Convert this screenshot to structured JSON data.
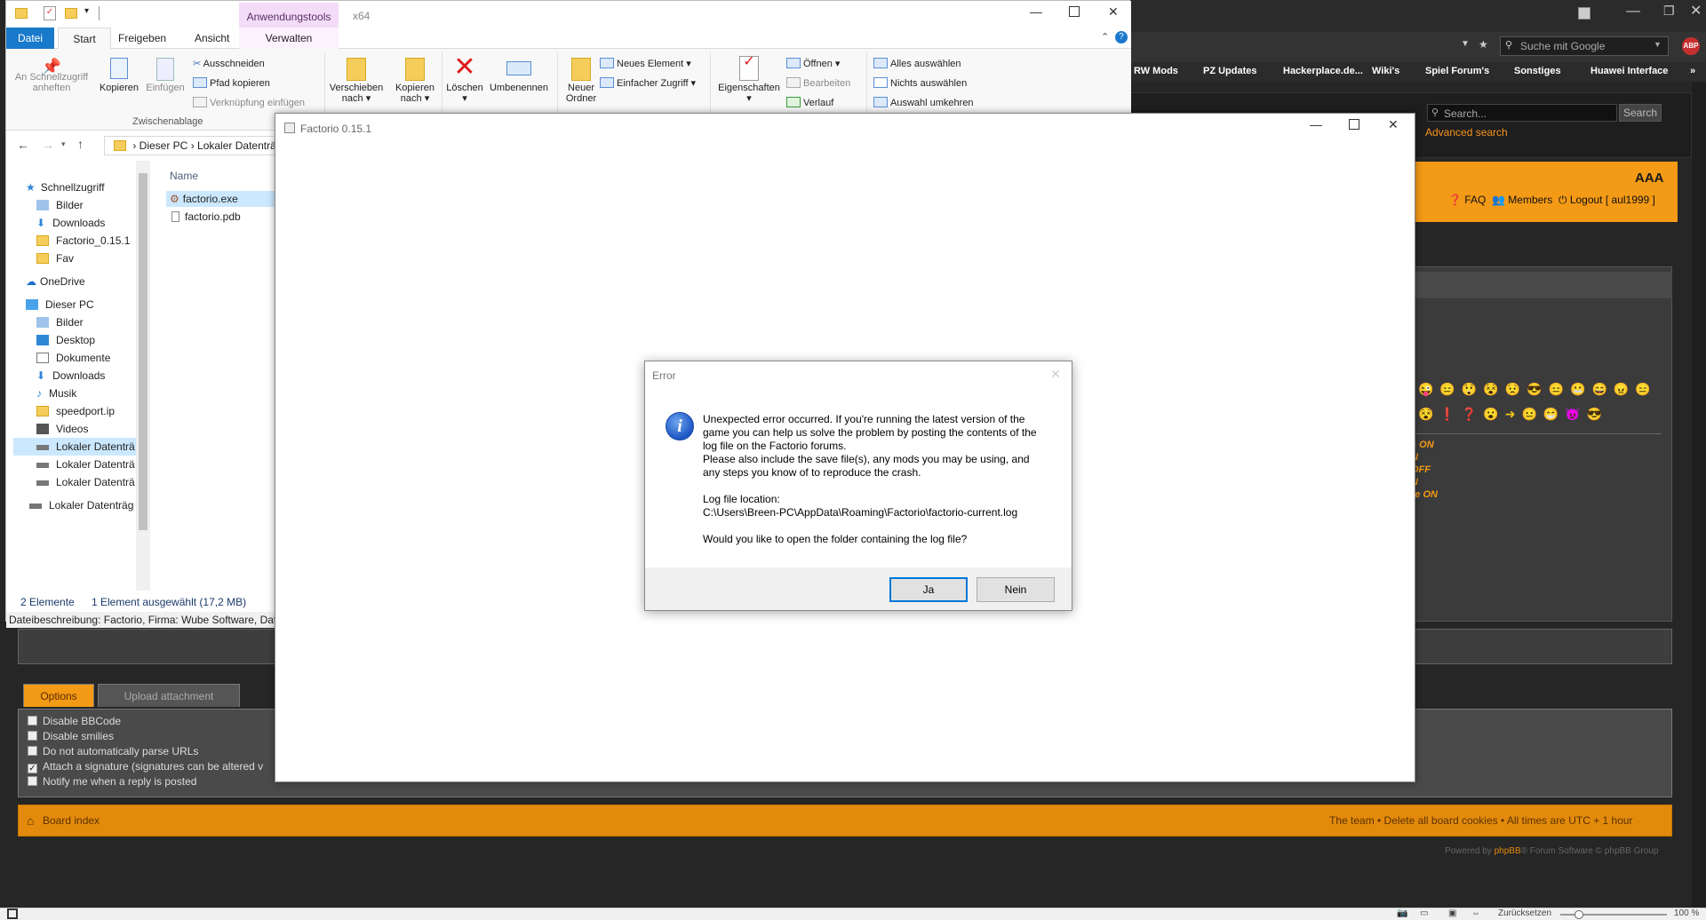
{
  "browser": {
    "search_placeholder": "Suche mit Google",
    "abp": "ABP",
    "bookmarks": [
      "RW Mods",
      "PZ Updates",
      "Hackerplace.de...",
      "Wiki's",
      "Spiel Forum's",
      "Sonstiges",
      "Huawei Interface"
    ],
    "bookmarks_more": "»",
    "status_reset": "Zurücksetzen",
    "zoom": "100 %"
  },
  "forum": {
    "search_placeholder": "Search...",
    "search_button": "Search",
    "advanced_search": "Advanced search",
    "font_size": "AAA",
    "faq": "FAQ",
    "members": "Members",
    "logout": "Logout [ aul1999 ]",
    "smilies_row1": "😜😑😲😵😟😎😑😬😄😠😑",
    "smilies_row2": "😵❗❓😮➜😐😁😈😎",
    "onoff": [
      "s ON",
      "N",
      "OFF",
      "N",
      "re ON"
    ],
    "tabs": {
      "options": "Options",
      "upload": "Upload attachment"
    },
    "options": [
      "Disable BBCode",
      "Disable smilies",
      "Do not automatically parse URLs",
      "Attach a signature (signatures can be altered v",
      "Notify me when a reply is posted"
    ],
    "options_checked": [
      false,
      false,
      false,
      true,
      false
    ],
    "board_index": "Board index",
    "footer_links": "The team  •  Delete all board cookies  •  All times are UTC + 1 hour",
    "powered_prefix": "Powered by ",
    "powered_brand": "phpBB",
    "powered_suffix": "® Forum Software © phpBB Group"
  },
  "explorer": {
    "context_tab": "Anwendungstools",
    "window_title": "x64",
    "tabs": [
      "Datei",
      "Start",
      "Freigeben",
      "Ansicht",
      "Verwalten"
    ],
    "ribbon": {
      "pin": "An Schnellzugriff anheften",
      "copy": "Kopieren",
      "paste": "Einfügen",
      "cut": "Ausschneiden",
      "copy_path": "Pfad kopieren",
      "paste_link": "Verknüpfung einfügen",
      "clipboard_group": "Zwischenablage",
      "move_to": "Verschieben nach",
      "copy_to": "Kopieren nach",
      "delete": "Löschen",
      "rename": "Umbenennen",
      "new_folder": "Neuer Ordner",
      "new_item": "Neues Element ▾",
      "easy_access": "Einfacher Zugriff ▾",
      "properties": "Eigenschaften",
      "open": "Öffnen ▾",
      "edit": "Bearbeiten",
      "history": "Verlauf",
      "select_all": "Alles auswählen",
      "select_none": "Nichts auswählen",
      "invert_selection": "Auswahl umkehren"
    },
    "address": [
      "Dieser PC",
      "Lokaler Datenträ"
    ],
    "nav_items": [
      "Schnellzugriff",
      "Bilder",
      "Downloads",
      "Factorio_0.15.1",
      "Fav",
      "OneDrive",
      "Dieser PC",
      "Bilder",
      "Desktop",
      "Dokumente",
      "Downloads",
      "Musik",
      "speedport.ip",
      "Videos",
      "Lokaler Datenträ",
      "Lokaler Datenträ",
      "Lokaler Datenträ",
      "Lokaler Datenträg"
    ],
    "column_name": "Name",
    "files": [
      "factorio.exe",
      "factorio.pdb"
    ],
    "status_count": "2 Elemente",
    "status_selected": "1 Element ausgewählt (17,2 MB)",
    "description": "Dateibeschreibung: Factorio, Firma: Wube Software, Date"
  },
  "factorio": {
    "title": "Factorio 0.15.1"
  },
  "dialog": {
    "title": "Error",
    "line1": "Unexpected error occurred. If you're running the latest version of the",
    "line2": "game you can help us solve the problem by posting the contents of the",
    "line3": "log file on the Factorio forums.",
    "line4": "Please also include the save file(s), any mods you may be using, and",
    "line5": "any steps you know of to reproduce the crash.",
    "log_label": "Log file location:",
    "log_path": "C:\\Users\\Breen-PC\\AppData\\Roaming\\Factorio\\factorio-current.log",
    "question": "Would you like to open the folder containing the log file?",
    "yes": "Ja",
    "no": "Nein"
  }
}
